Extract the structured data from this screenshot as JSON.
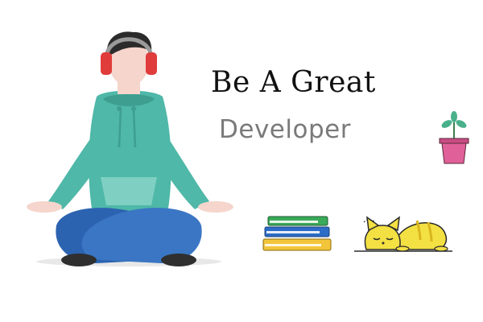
{
  "headline": {
    "line1": "Be A Great",
    "line2": "Developer"
  },
  "illustration": {
    "person": "meditating-developer-with-headphones",
    "objects": [
      "book-stack",
      "sleeping-cat",
      "potted-plant"
    ]
  },
  "colors": {
    "hoodie": "#4fb8a8",
    "hoodie_shadow": "#3e9e90",
    "jeans": "#2c63b0",
    "jeans_light": "#3a76c4",
    "headphones": "#e03c3c",
    "skin": "#f5d5cc",
    "hair": "#2b2b2b",
    "shoes": "#2f2f2f",
    "cat": "#f3e042",
    "pot": "#e0619a",
    "leaf": "#49b08c",
    "book_green": "#3aaa5a",
    "book_blue": "#2c6cc6",
    "book_yellow": "#f2c53a",
    "title": "#111111",
    "subtitle": "#7a7a7a"
  }
}
